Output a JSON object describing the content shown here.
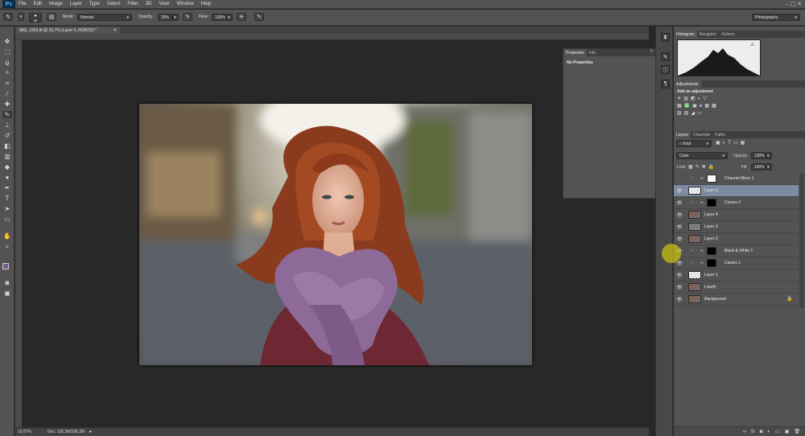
{
  "menubar": {
    "logo": "Ps",
    "items": [
      "File",
      "Edit",
      "Image",
      "Layer",
      "Type",
      "Select",
      "Filter",
      "3D",
      "View",
      "Window",
      "Help"
    ]
  },
  "options": {
    "brush_size": "65",
    "mode_label": "Mode:",
    "mode_value": "Normal",
    "opacity_label": "Opacity:",
    "opacity_value": "20%",
    "flow_label": "Flow:",
    "flow_value": "100%",
    "workspace": "Photography"
  },
  "document": {
    "tab_title": "IMG_1962.tif @ 16,7% (Layer 5, RGB/16) *",
    "zoom": "16,67%",
    "doc_info": "Doc: 125,3M/336,2M"
  },
  "properties_panel": {
    "tabs": [
      "Properties",
      "Info"
    ],
    "content": "No Properties"
  },
  "histogram_panel": {
    "tabs": [
      "Histogram",
      "Navigator",
      "Actions"
    ]
  },
  "adjustments_panel": {
    "tabs": [
      "Adjustments"
    ],
    "title": "Add an adjustment"
  },
  "layers_panel": {
    "tabs": [
      "Layers",
      "Channels",
      "Paths"
    ],
    "filter_kind": "Kind",
    "blend_mode": "Color",
    "opacity_label": "Opacity:",
    "opacity_value": "100%",
    "lock_label": "Lock:",
    "fill_label": "Fill:",
    "fill_value": "100%",
    "layers": [
      {
        "name": "Channel Mixer 1",
        "type": "adjustment",
        "visible": false,
        "mask": "white",
        "selected": false
      },
      {
        "name": "Layer 5",
        "type": "pixel",
        "visible": true,
        "thumb": "transparent",
        "selected": true
      },
      {
        "name": "Curves 2",
        "type": "adjustment",
        "visible": true,
        "mask": "black",
        "selected": false
      },
      {
        "name": "Layer 4",
        "type": "pixel",
        "visible": true,
        "thumb": "photo",
        "selected": false
      },
      {
        "name": "Layer 3",
        "type": "pixel",
        "visible": true,
        "thumb": "gray",
        "selected": false
      },
      {
        "name": "Layer 2",
        "type": "pixel",
        "visible": true,
        "thumb": "photo",
        "selected": false
      },
      {
        "name": "Black & White 1",
        "type": "adjustment",
        "visible": true,
        "mask": "black",
        "selected": false
      },
      {
        "name": "Curves 1",
        "type": "adjustment",
        "visible": true,
        "mask": "black",
        "selected": false
      },
      {
        "name": "Layer 1",
        "type": "pixel",
        "visible": true,
        "thumb": "transparent",
        "selected": false
      },
      {
        "name": "Liquify",
        "type": "pixel",
        "visible": true,
        "thumb": "photo",
        "selected": false
      },
      {
        "name": "Background",
        "type": "pixel",
        "visible": true,
        "thumb": "photo",
        "selected": false,
        "locked": true
      }
    ],
    "footer_icons": [
      "link-icon",
      "fx-icon",
      "mask-icon",
      "adjustment-icon",
      "group-icon",
      "new-layer-icon",
      "trash-icon"
    ]
  },
  "colors": {
    "accent_selected": "#7d8ba1",
    "panel_bg": "#535353",
    "canvas_bg": "#282828",
    "foreground_swatch": "#7a5a8c",
    "background_swatch": "#1a1a1a"
  }
}
